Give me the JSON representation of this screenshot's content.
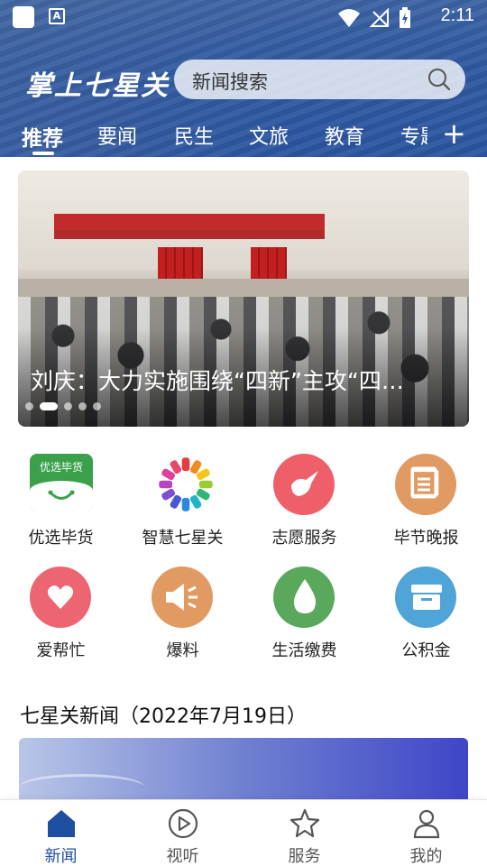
{
  "status_bar": {
    "time": "2:11",
    "icons": [
      "app-square-icon",
      "font-a-icon",
      "wifi-icon",
      "no-signal-icon",
      "battery-charging-icon"
    ]
  },
  "header": {
    "logo_text": "掌上七星关",
    "search_placeholder": "新闻搜索",
    "tabs": [
      {
        "label": "推荐",
        "active": true
      },
      {
        "label": "要闻"
      },
      {
        "label": "民生"
      },
      {
        "label": "文旅"
      },
      {
        "label": "教育"
      },
      {
        "label": "专题"
      }
    ],
    "add_tab_symbol": "+"
  },
  "banner": {
    "title": "刘庆：大力实施围绕“四新”主攻“四…",
    "dot_count": 5,
    "active_dot": 1
  },
  "services": [
    {
      "label": "优选毕货",
      "icon": "youxuan-bihuo-icon",
      "icon_text": "优选毕货",
      "color": "#3aa14a"
    },
    {
      "label": "智慧七星关",
      "icon": "colorful-flower-icon"
    },
    {
      "label": "志愿服务",
      "icon": "volunteer-hand-icon",
      "color": "#ee5f6a"
    },
    {
      "label": "毕节晚报",
      "icon": "newspaper-icon",
      "color": "#e09a62"
    },
    {
      "label": "爱帮忙",
      "icon": "heart-icon",
      "color": "#ee6572"
    },
    {
      "label": "爆料",
      "icon": "megaphone-icon",
      "color": "#e29a63"
    },
    {
      "label": "生活缴费",
      "icon": "water-drop-icon",
      "color": "#5aa85b"
    },
    {
      "label": "公积金",
      "icon": "box-icon",
      "color": "#4fa4d8"
    }
  ],
  "news_section": {
    "title": "七星关新闻（2022年7月19日）"
  },
  "bottom_nav": [
    {
      "label": "新闻",
      "icon": "home-icon",
      "active": true
    },
    {
      "label": "视听",
      "icon": "play-circle-icon"
    },
    {
      "label": "服务",
      "icon": "star-icon"
    },
    {
      "label": "我的",
      "icon": "person-icon"
    }
  ],
  "colors": {
    "header_blue": "#2e58a0",
    "active_nav": "#1f4fa0",
    "inactive_nav": "#555555"
  }
}
